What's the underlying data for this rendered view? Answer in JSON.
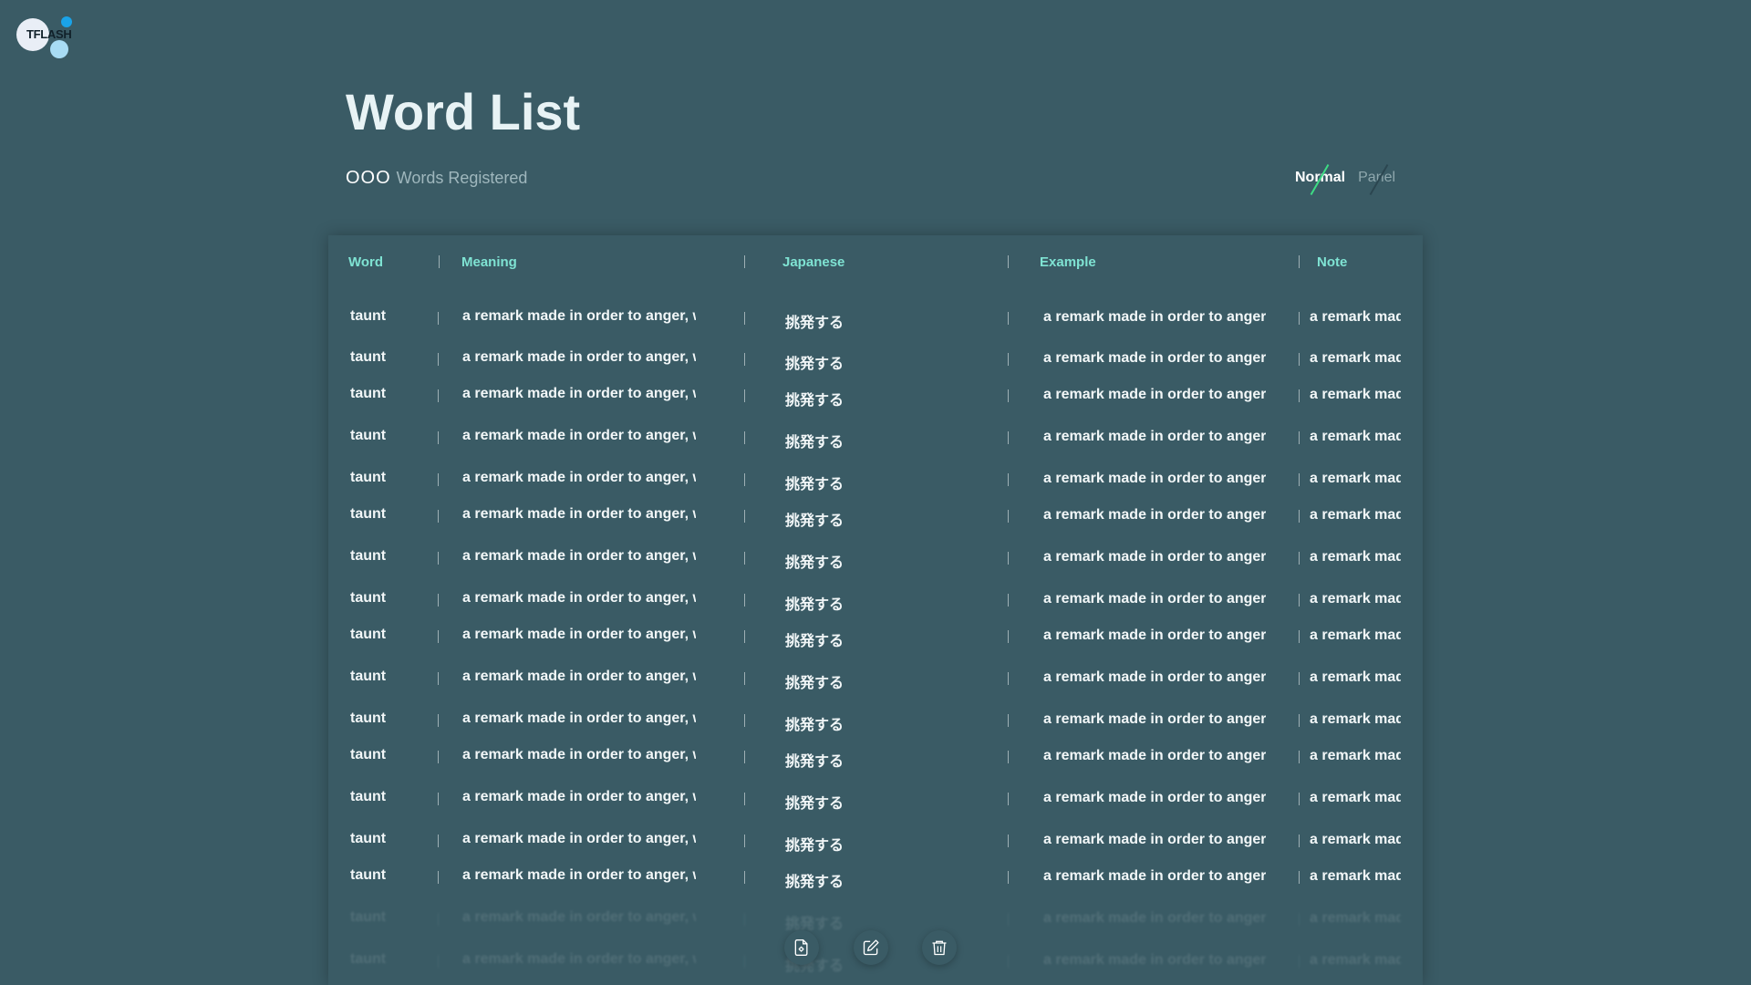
{
  "app": {
    "logo_text": "TFLASH"
  },
  "header": {
    "title": "Word List",
    "count_placeholder": "OOO",
    "count_label": "Words Registered"
  },
  "view_toggle": {
    "normal_label": "Normal",
    "panel_label": "Panel",
    "selected": "Normal"
  },
  "table": {
    "columns": [
      "Word",
      "Meaning",
      "Japanese",
      "Example",
      "Note"
    ],
    "rows": [
      {
        "word": "taunt",
        "meaning": "a remark made in order to anger, worry or upset someone",
        "japanese": "挑発する",
        "example": "a remark made in order to anger, worry or upset someone",
        "note": "a remark made in order to anger, worry or upset someone"
      },
      {
        "word": "taunt",
        "meaning": "a remark made in order to anger, worry or upset someone",
        "japanese": "挑発する",
        "example": "a remark made in order to anger, worry or upset someone",
        "note": "a remark made in order to anger, worry or upset someone"
      },
      {
        "word": "taunt",
        "meaning": "a remark made in order to anger, worry or upset someone",
        "japanese": "挑発する",
        "example": "a remark made in order to anger, worry or upset someone",
        "note": "a remark made in order to anger, worry or upset someone"
      },
      {
        "word": "taunt",
        "meaning": "a remark made in order to anger, worry or upset someone",
        "japanese": "挑発する",
        "example": "a remark made in order to anger, worry or upset someone",
        "note": "a remark made in order to anger, worry or upset someone"
      },
      {
        "word": "taunt",
        "meaning": "a remark made in order to anger, worry or upset someone",
        "japanese": "挑発する",
        "example": "a remark made in order to anger, worry or upset someone",
        "note": "a remark made in order to anger, worry or upset someone"
      },
      {
        "word": "taunt",
        "meaning": "a remark made in order to anger, worry or upset someone",
        "japanese": "挑発する",
        "example": "a remark made in order to anger, worry or upset someone",
        "note": "a remark made in order to anger, worry or upset someone"
      },
      {
        "word": "taunt",
        "meaning": "a remark made in order to anger, worry or upset someone",
        "japanese": "挑発する",
        "example": "a remark made in order to anger, worry or upset someone",
        "note": "a remark made in order to anger, worry or upset someone"
      },
      {
        "word": "taunt",
        "meaning": "a remark made in order to anger, worry or upset someone",
        "japanese": "挑発する",
        "example": "a remark made in order to anger, worry or upset someone",
        "note": "a remark made in order to anger, worry or upset someone"
      },
      {
        "word": "taunt",
        "meaning": "a remark made in order to anger, worry or upset someone",
        "japanese": "挑発する",
        "example": "a remark made in order to anger, worry or upset someone",
        "note": "a remark made in order to anger, worry or upset someone"
      },
      {
        "word": "taunt",
        "meaning": "a remark made in order to anger, worry or upset someone",
        "japanese": "挑発する",
        "example": "a remark made in order to anger, worry or upset someone",
        "note": "a remark made in order to anger, worry or upset someone"
      },
      {
        "word": "taunt",
        "meaning": "a remark made in order to anger, worry or upset someone",
        "japanese": "挑発する",
        "example": "a remark made in order to anger, worry or upset someone",
        "note": "a remark made in order to anger, worry or upset someone"
      },
      {
        "word": "taunt",
        "meaning": "a remark made in order to anger, worry or upset someone",
        "japanese": "挑発する",
        "example": "a remark made in order to anger, worry or upset someone",
        "note": "a remark made in order to anger, worry or upset someone"
      },
      {
        "word": "taunt",
        "meaning": "a remark made in order to anger, worry or upset someone",
        "japanese": "挑発する",
        "example": "a remark made in order to anger, worry or upset someone",
        "note": "a remark made in order to anger, worry or upset someone"
      },
      {
        "word": "taunt",
        "meaning": "a remark made in order to anger, worry or upset someone",
        "japanese": "挑発する",
        "example": "a remark made in order to anger, worry or upset someone",
        "note": "a remark made in order to anger, worry or upset someone"
      },
      {
        "word": "taunt",
        "meaning": "a remark made in order to anger, worry or upset someone",
        "japanese": "挑発する",
        "example": "a remark made in order to anger, worry or upset someone",
        "note": "a remark made in order to anger, worry or upset someone"
      },
      {
        "word": "taunt",
        "meaning": "a remark made in order to anger, worry or upset someone",
        "japanese": "挑発する",
        "example": "a remark made in order to anger, worry or upset someone",
        "note": "a remark made in order to anger, worry or upset someone"
      },
      {
        "word": "taunt",
        "meaning": "a remark made in order to anger, worry or upset someone",
        "japanese": "挑発する",
        "example": "a remark made in order to anger, worry or upset someone",
        "note": "a remark made in order to anger, worry or upset someone"
      }
    ]
  },
  "actions": [
    {
      "icon": "document-settings-icon",
      "name": "new-word-button"
    },
    {
      "icon": "edit-icon",
      "name": "edit-button"
    },
    {
      "icon": "trash-icon",
      "name": "delete-button"
    }
  ]
}
